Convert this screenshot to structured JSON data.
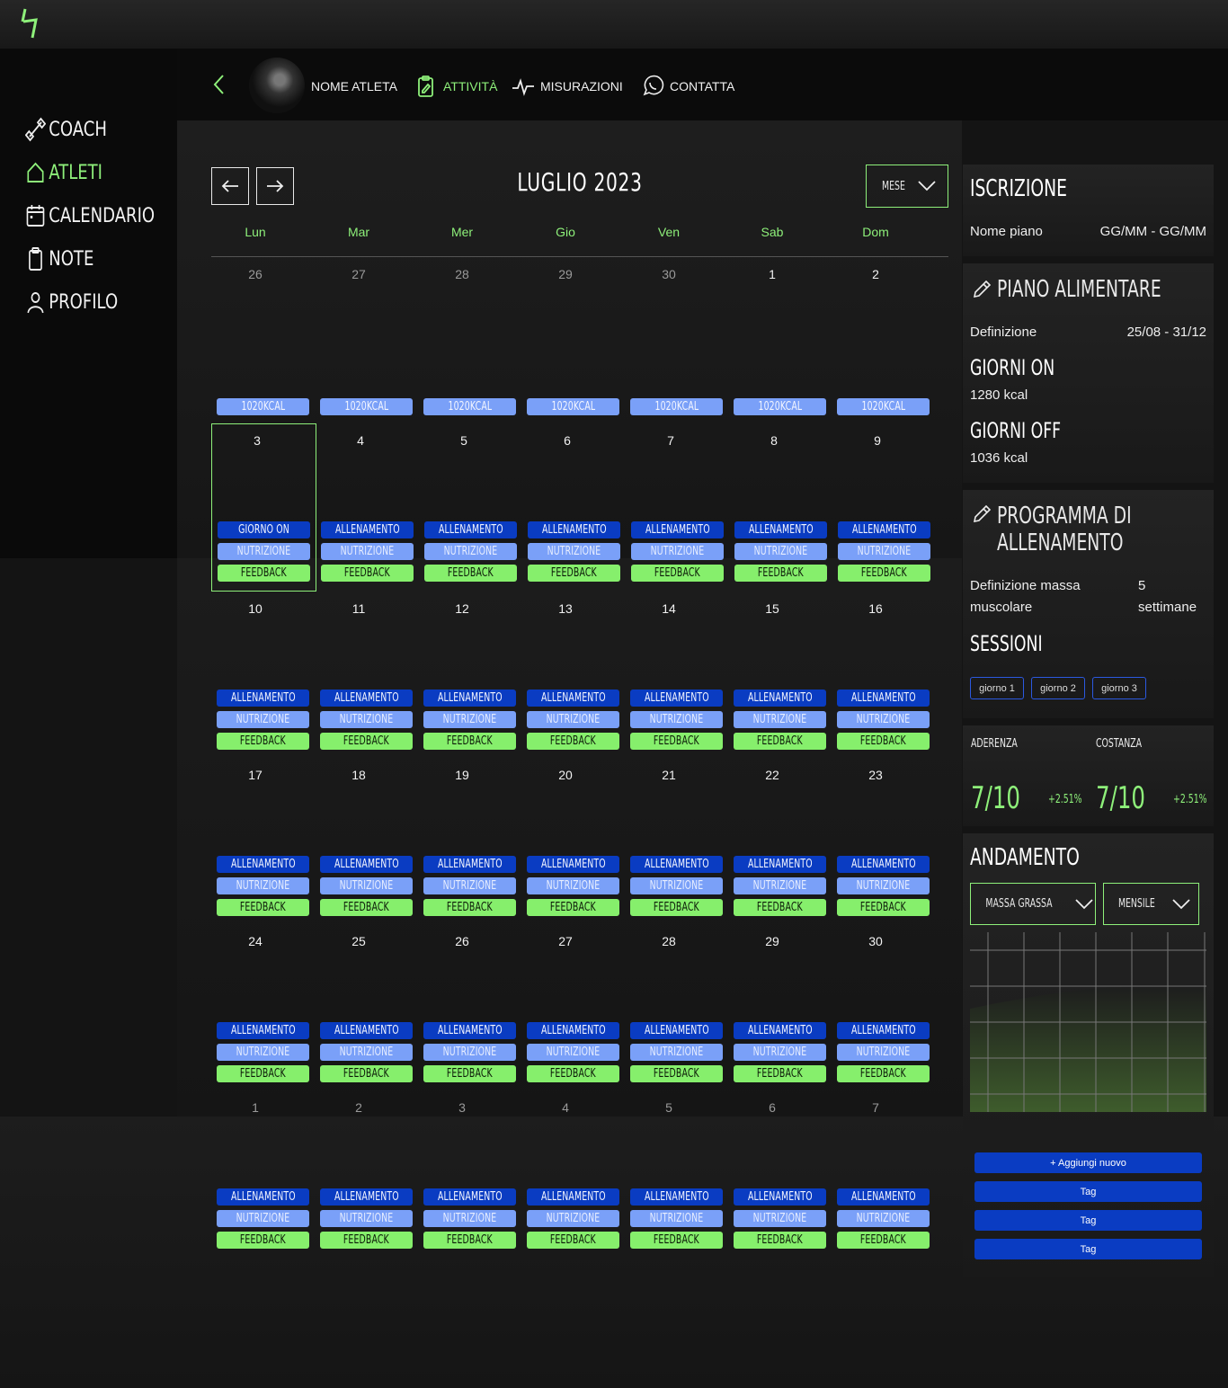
{
  "app": {
    "logo": "logo-icon"
  },
  "sidebar": {
    "items": [
      {
        "label": "COACH",
        "icon": "dumbbell-icon"
      },
      {
        "label": "ATLETI",
        "icon": "home-icon"
      },
      {
        "label": "CALENDARIO",
        "icon": "calendar-icon"
      },
      {
        "label": "NOTE",
        "icon": "clipboard-icon"
      },
      {
        "label": "PROFILO",
        "icon": "user-icon"
      }
    ]
  },
  "athlete": {
    "name": "NOME ATLETA",
    "tabs": [
      {
        "label": "ATTIVITÀ",
        "icon": "clipboard-edit-icon"
      },
      {
        "label": "MISURAZIONI",
        "icon": "pulse-icon"
      },
      {
        "label": "CONTATTA",
        "icon": "whatsapp-icon"
      }
    ]
  },
  "calendar": {
    "title": "LUGLIO 2023",
    "view": "MESE",
    "weekdays": [
      "Lun",
      "Mar",
      "Mer",
      "Gio",
      "Ven",
      "Sab",
      "Dom"
    ],
    "weeks": [
      {
        "days": [
          "26",
          "27",
          "28",
          "29",
          "30",
          "1",
          "2"
        ],
        "muted": [
          true,
          true,
          true,
          true,
          true,
          false,
          false
        ],
        "tags": [
          "1020KCAL"
        ]
      },
      {
        "days": [
          "3",
          "4",
          "5",
          "6",
          "7",
          "8",
          "9"
        ],
        "muted": [
          false,
          false,
          false,
          false,
          false,
          false,
          false
        ],
        "first_tag": "GIORNO ON",
        "tags": [
          "ALLENAMENTO",
          "NUTRIZIONE",
          "FEEDBACK"
        ]
      },
      {
        "days": [
          "10",
          "11",
          "12",
          "13",
          "14",
          "15",
          "16"
        ],
        "muted": [
          false,
          false,
          false,
          false,
          false,
          false,
          false
        ],
        "tags": [
          "ALLENAMENTO",
          "NUTRIZIONE",
          "FEEDBACK"
        ]
      },
      {
        "days": [
          "17",
          "18",
          "19",
          "20",
          "21",
          "22",
          "23"
        ],
        "muted": [
          false,
          false,
          false,
          false,
          false,
          false,
          false
        ],
        "tags": [
          "ALLENAMENTO",
          "NUTRIZIONE",
          "FEEDBACK"
        ]
      },
      {
        "days": [
          "24",
          "25",
          "26",
          "27",
          "28",
          "29",
          "30"
        ],
        "muted": [
          false,
          false,
          false,
          false,
          false,
          false,
          false
        ],
        "tags": [
          "ALLENAMENTO",
          "NUTRIZIONE",
          "FEEDBACK"
        ]
      },
      {
        "days": [
          "1",
          "2",
          "3",
          "4",
          "5",
          "6",
          "7"
        ],
        "muted": [
          true,
          true,
          true,
          true,
          true,
          true,
          true
        ],
        "tags": [
          "ALLENAMENTO",
          "NUTRIZIONE",
          "FEEDBACK"
        ]
      }
    ]
  },
  "iscrizione": {
    "title": "ISCRIZIONE",
    "plan_label": "Nome piano",
    "plan_dates": "GG/MM - GG/MM"
  },
  "piano": {
    "title": "PIANO ALIMENTARE",
    "type": "Definizione",
    "dates": "25/08 - 31/12",
    "on_title": "GIORNI ON",
    "on_kcal": "1280 kcal",
    "off_title": "GIORNI OFF",
    "off_kcal": "1036 kcal"
  },
  "programma": {
    "title_line1": "PROGRAMMA DI",
    "title_line2": "ALLENAMENTO",
    "name_line1": "Definizione massa",
    "name_line2": "muscolare",
    "weeks_line1": "5",
    "weeks_line2": "settimane",
    "sessions_title": "SESSIONI",
    "sessions": [
      "giorno 1",
      "giorno 2",
      "giorno 3"
    ]
  },
  "scores": {
    "adherence_label": "ADERENZA",
    "adherence_value": "7/10",
    "adherence_delta": "+2.51%",
    "consistency_label": "COSTANZA",
    "consistency_value": "7/10",
    "consistency_delta": "+2.51%"
  },
  "andamento": {
    "title": "ANDAMENTO",
    "metric": "MASSA GRASSA",
    "period": "MENSILE"
  },
  "actions": {
    "add": "+ Aggiungi nuovo",
    "tags": [
      "Tag",
      "Tag",
      "Tag"
    ]
  },
  "colors": {
    "accent": "#8ef07a",
    "blue": "#0a3cc2",
    "light_blue": "#7aa0f8",
    "bg": "#141414"
  }
}
